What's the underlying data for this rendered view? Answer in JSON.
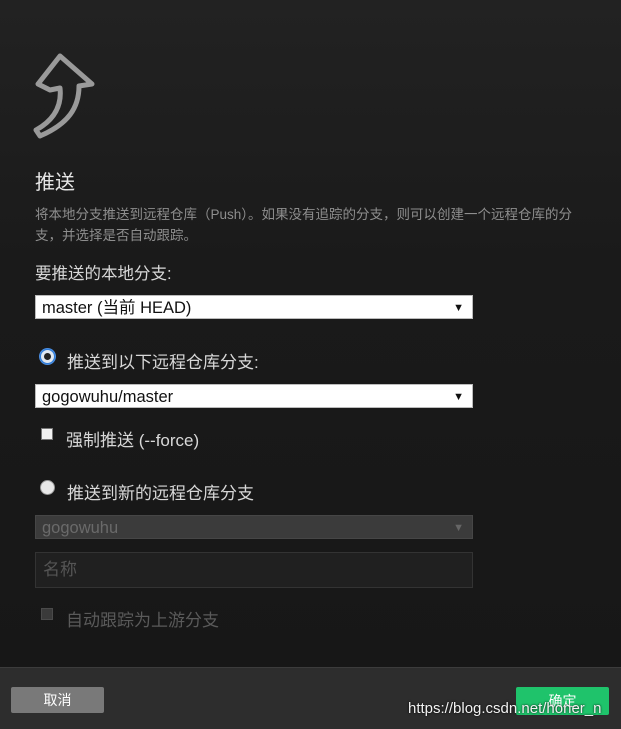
{
  "dialog": {
    "title": "推送",
    "description": "将本地分支推送到远程仓库（Push）。如果没有追踪的分支，则可以创建一个远程仓库的分支，并选择是否自动跟踪。",
    "local_branch_label": "要推送的本地分支:",
    "local_branch_value": "master (当前 HEAD)",
    "push_existing_label": "推送到以下远程仓库分支:",
    "remote_branch_value": "gogowuhu/master",
    "force_label": "强制推送 (--force)",
    "push_new_label": "推送到新的远程仓库分支",
    "remote_select_value": "gogowuhu",
    "name_placeholder": "名称",
    "auto_track_label": "自动跟踪为上游分支",
    "caret": "▼"
  },
  "footer": {
    "cancel_label": "取消",
    "ok_label": "确定"
  },
  "watermark": "https://blog.csdn.net/honer_n",
  "colors": {
    "background": "#1b1b1b",
    "ok_button": "#1fc36b",
    "cancel_button": "#797979",
    "radio_focus": "#2d7ad6"
  },
  "icons": {
    "logo": "push-arrow-icon",
    "dropdown": "chevron-down-icon"
  },
  "state": {
    "push_existing_selected": true,
    "push_new_selected": false,
    "force_checked": false,
    "auto_track_checked": false,
    "new_branch_disabled": true
  }
}
